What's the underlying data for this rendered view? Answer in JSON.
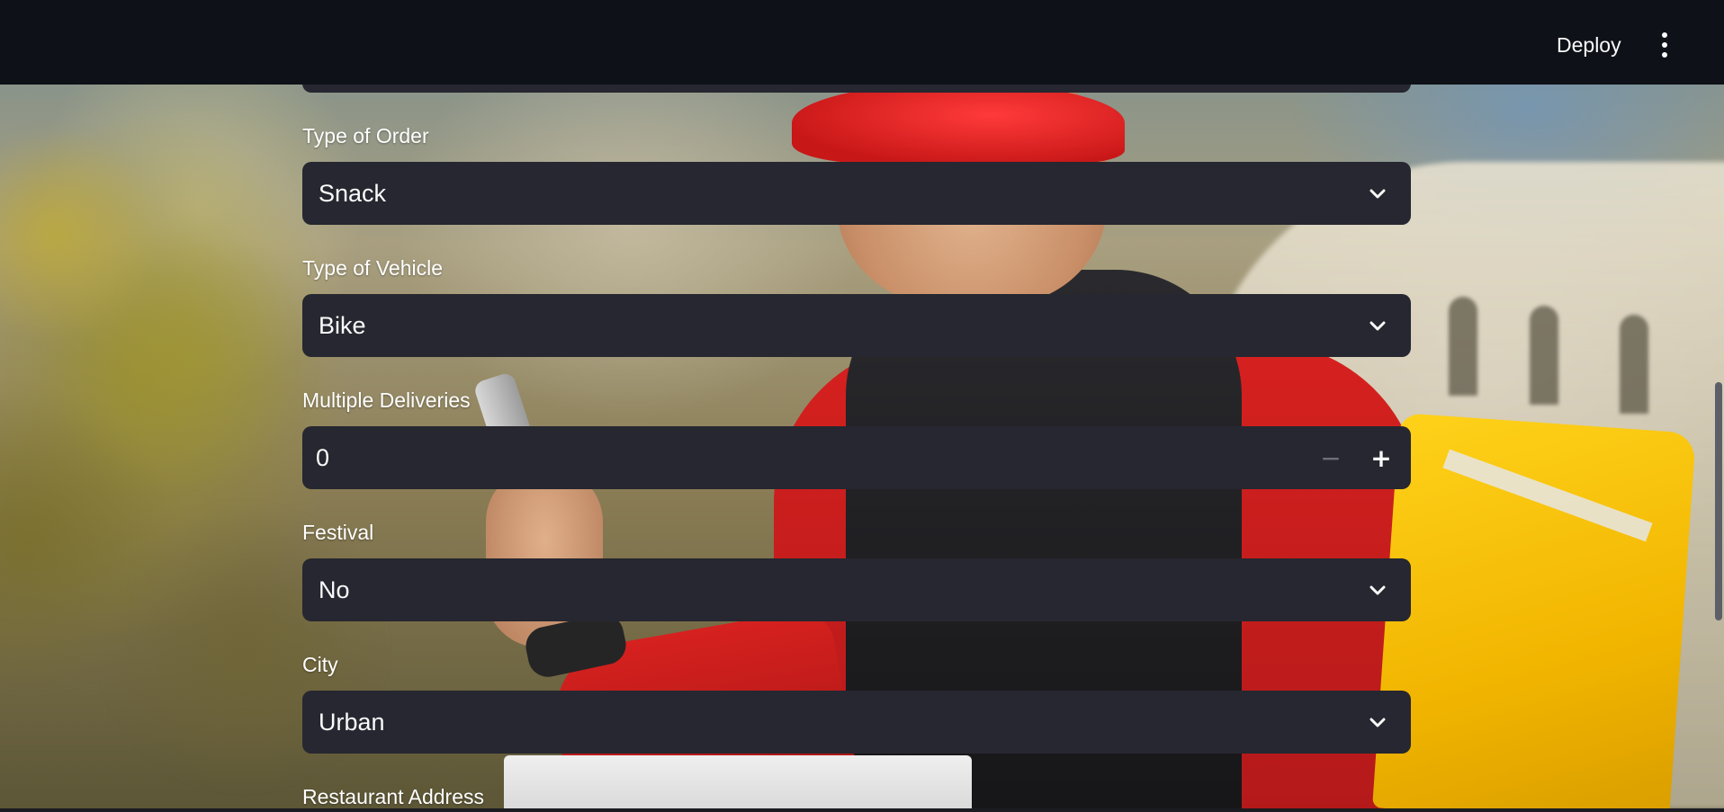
{
  "header": {
    "deploy_label": "Deploy",
    "menu_icon": "vertical-ellipsis-icon"
  },
  "form": {
    "type_of_order": {
      "label": "Type of Order",
      "value": "Snack"
    },
    "type_of_vehicle": {
      "label": "Type of Vehicle",
      "value": "Bike"
    },
    "multiple_deliveries": {
      "label": "Multiple Deliveries",
      "value": "0",
      "decrement_icon": "minus-icon",
      "increment_icon": "plus-icon"
    },
    "festival": {
      "label": "Festival",
      "value": "No"
    },
    "city": {
      "label": "City",
      "value": "Urban"
    },
    "restaurant_address": {
      "label": "Restaurant Address"
    }
  },
  "colors": {
    "header_bg": "#0e1117",
    "field_bg": "#262730",
    "text": "#fafafa"
  }
}
